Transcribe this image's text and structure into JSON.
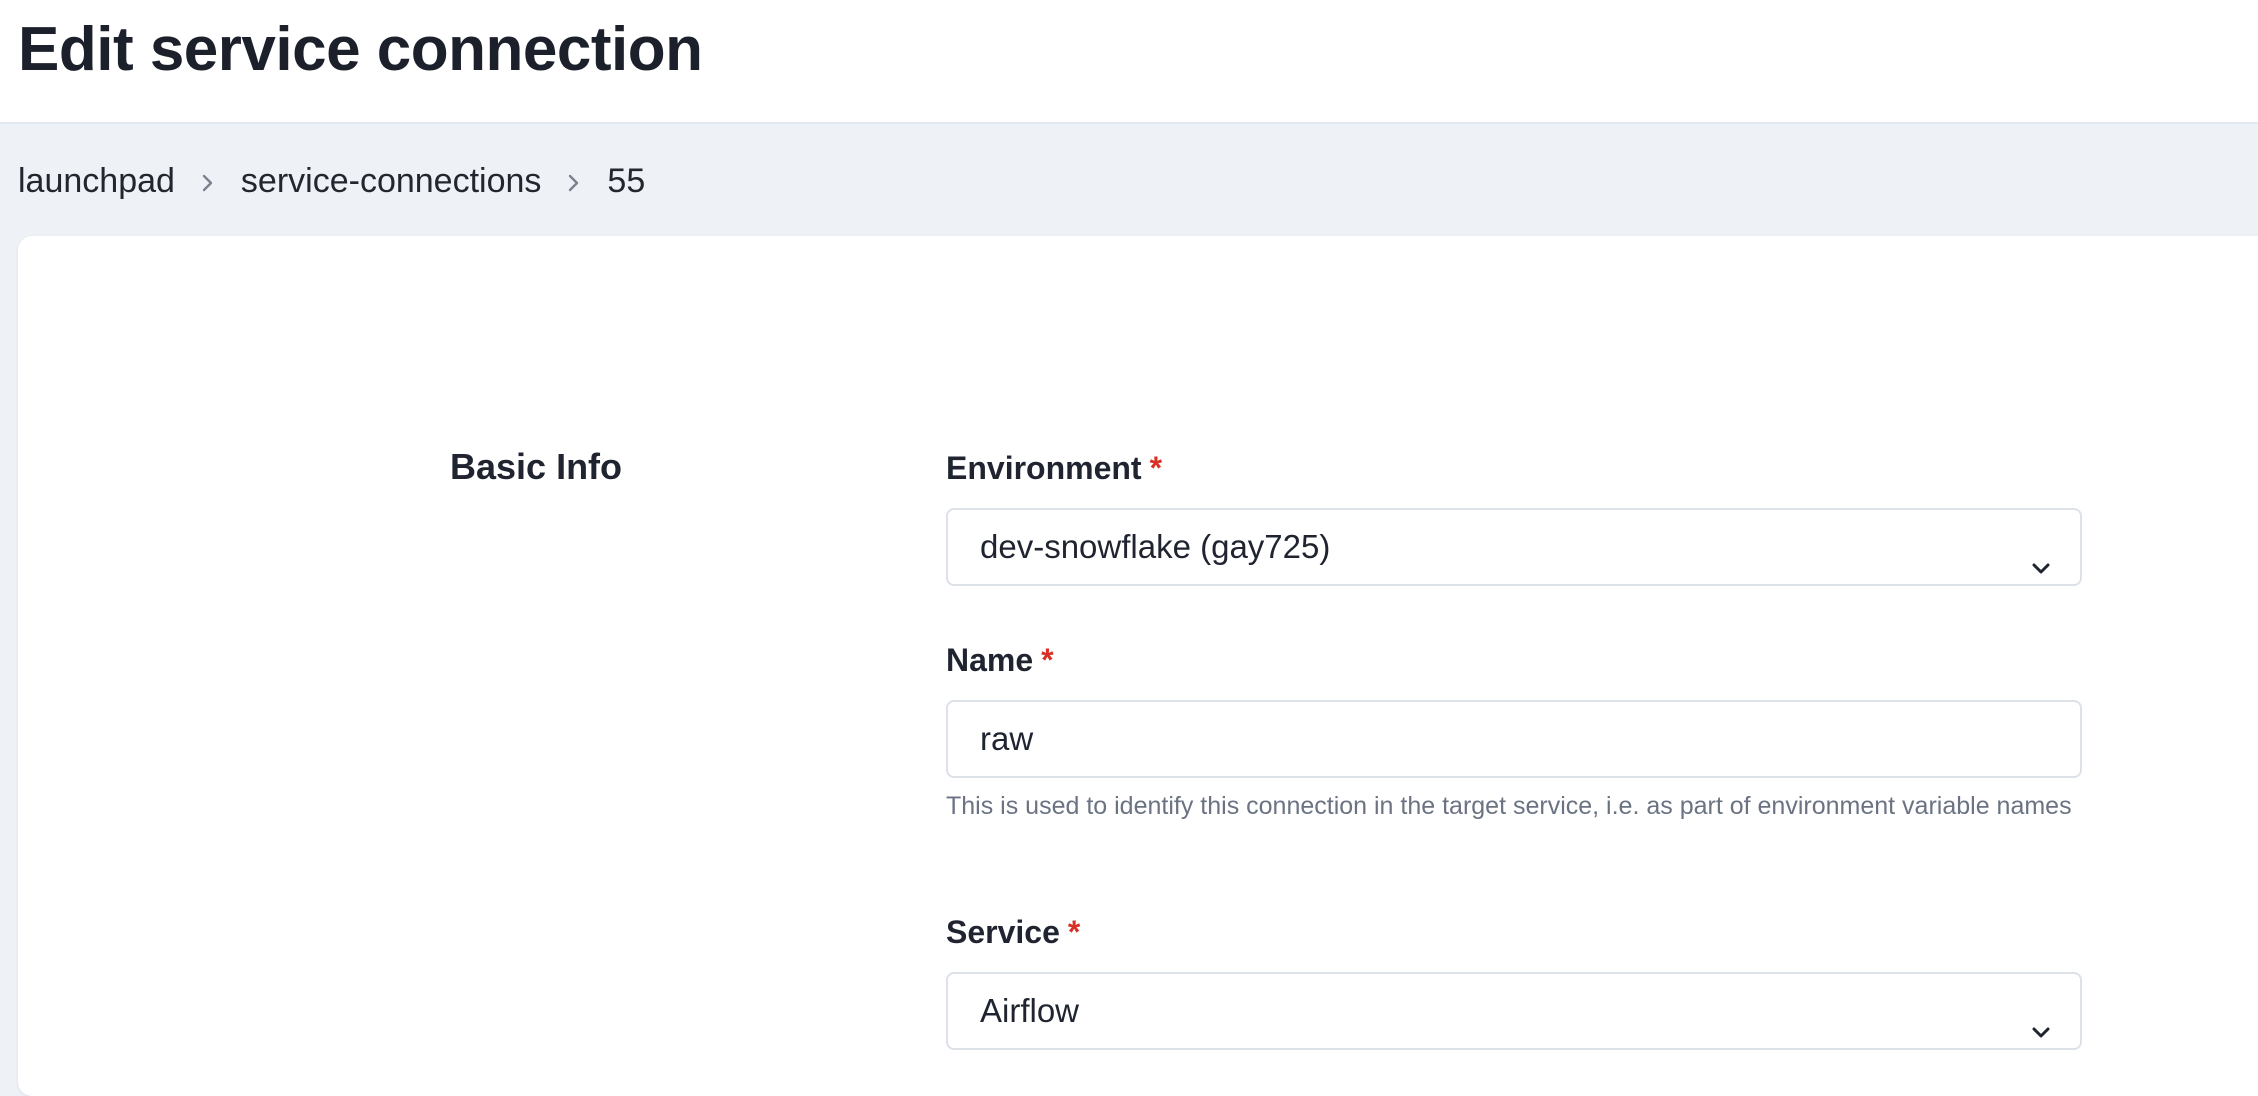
{
  "header": {
    "title": "Edit service connection"
  },
  "breadcrumb": {
    "items": [
      "launchpad",
      "service-connections",
      "55"
    ]
  },
  "form": {
    "section_title": "Basic Info",
    "required_marker": "*",
    "environment": {
      "label": "Environment",
      "value": "dev-snowflake (gay725)"
    },
    "name": {
      "label": "Name",
      "value": "raw",
      "help": "This is used to identify this connection in the target service, i.e. as part of environment variable names"
    },
    "service": {
      "label": "Service",
      "value": "Airflow"
    }
  },
  "icons": {
    "breadcrumb_separator": "chevron-right-icon",
    "select_indicator": "chevron-down-icon"
  },
  "colors": {
    "page_background": "#eef1f6",
    "required": "#d93025",
    "help_text": "#6b7383",
    "border": "#dde1e8"
  }
}
